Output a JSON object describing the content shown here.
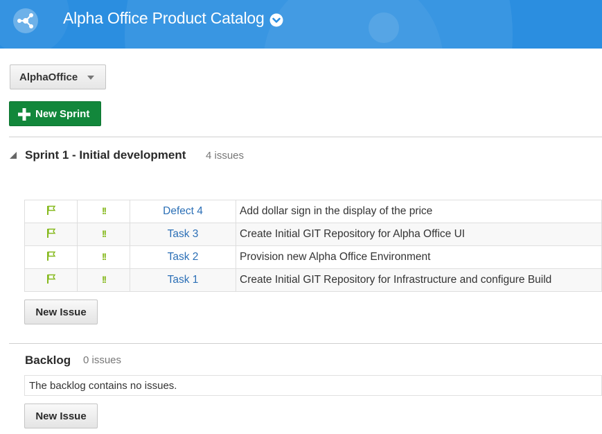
{
  "header": {
    "logo_icon": "project-hub-icon",
    "title": "Alpha Office Product Catalog",
    "title_menu_icon": "chevron-down-circle-icon",
    "banner_color": "#2b8ee0"
  },
  "project_selector": {
    "value": "AlphaOffice",
    "caret_icon": "caret-down-icon"
  },
  "new_sprint_button": {
    "label": "New Sprint",
    "icon": "plus-icon",
    "color": "#12873b"
  },
  "sprint": {
    "toggle_icon": "collapse-triangle-icon",
    "title": "Sprint 1 - Initial development",
    "count": "4 issues",
    "issues": [
      {
        "type_icon": "flag-icon",
        "priority": "!!",
        "id": "Defect 4",
        "summary": "Add dollar sign in the display of the price"
      },
      {
        "type_icon": "flag-icon",
        "priority": "!!",
        "id": "Task 3",
        "summary": "Create Initial GIT Repository for Alpha Office UI"
      },
      {
        "type_icon": "flag-icon",
        "priority": "!!",
        "id": "Task 2",
        "summary": "Provision new Alpha Office Environment"
      },
      {
        "type_icon": "flag-icon",
        "priority": "!!",
        "id": "Task 1",
        "summary": "Create Initial GIT Repository for Infrastructure and configure Build"
      }
    ],
    "new_issue_label": "New Issue"
  },
  "backlog": {
    "title": "Backlog",
    "count": "0 issues",
    "empty_message": "The backlog contains no issues.",
    "new_issue_label": "New Issue"
  }
}
